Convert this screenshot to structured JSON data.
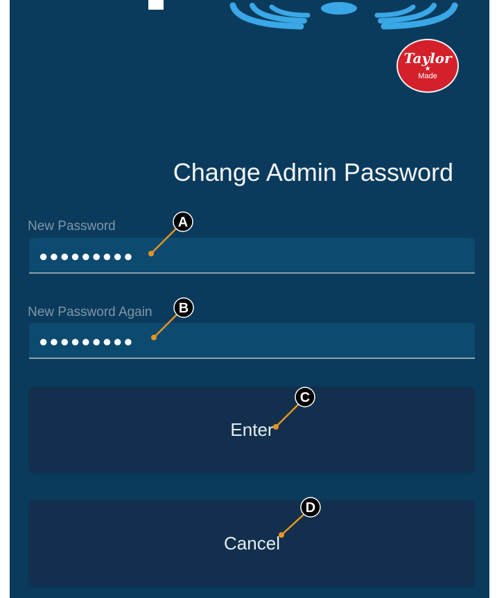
{
  "app": {
    "title": "Change Admin Password"
  },
  "logo": {
    "line1": "Taylor",
    "star": "★",
    "line2": "Made",
    "color": "#d4202a"
  },
  "form": {
    "new_password": {
      "label": "New Password",
      "value": "●●●●●●●●●"
    },
    "new_password_again": {
      "label": "New Password Again",
      "value": "●●●●●●●●●"
    }
  },
  "buttons": {
    "enter": "Enter",
    "cancel": "Cancel"
  },
  "callouts": {
    "a": "A",
    "b": "B",
    "c": "C",
    "d": "D"
  },
  "colors": {
    "background": "#0b3b5c",
    "field": "#0d4a70",
    "button": "#12304d",
    "callout_line": "#e8951f"
  }
}
